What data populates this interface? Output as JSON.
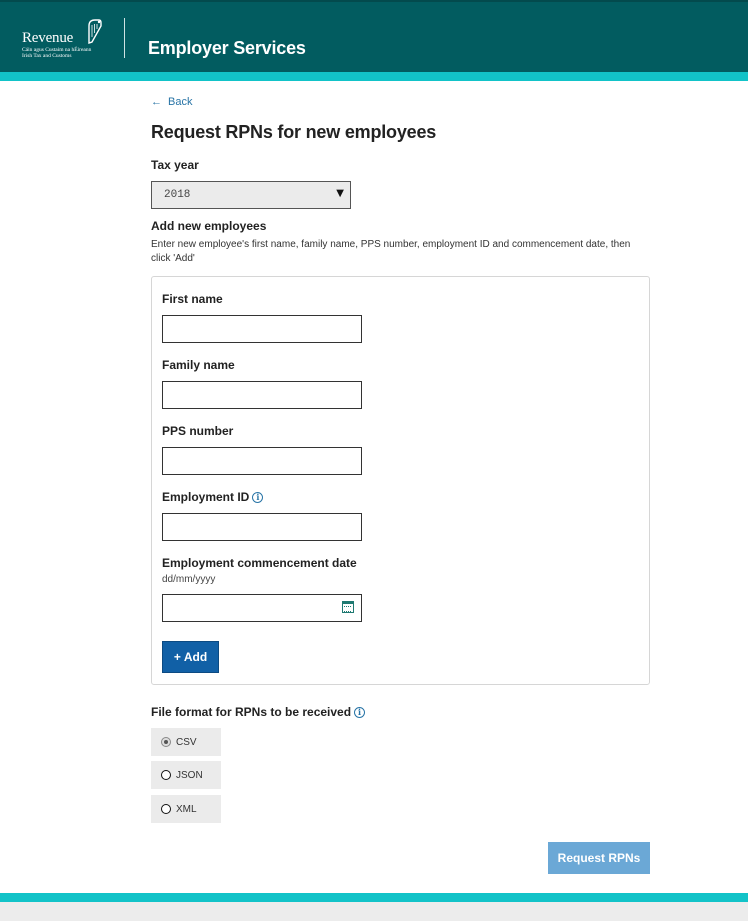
{
  "header": {
    "logo_name": "Revenue",
    "logo_sub_irish": "Cáin agus Custaim na hÉireann",
    "logo_sub_english": "Irish Tax and Customs",
    "title": "Employer Services"
  },
  "nav": {
    "back_label": "Back"
  },
  "page": {
    "title": "Request RPNs for new employees"
  },
  "tax_year": {
    "label": "Tax year",
    "selected": "2018"
  },
  "add_employees": {
    "label": "Add new employees",
    "help": "Enter new employee's first name, family name, PPS number, employment ID and commencement date, then click 'Add'",
    "fields": {
      "first_name": {
        "label": "First name",
        "value": ""
      },
      "family_name": {
        "label": "Family name",
        "value": ""
      },
      "pps_number": {
        "label": "PPS number",
        "value": ""
      },
      "employment_id": {
        "label": "Employment ID",
        "value": ""
      },
      "commencement_date": {
        "label": "Employment commencement date",
        "hint": "dd/mm/yyyy",
        "value": ""
      }
    },
    "add_button": "Add"
  },
  "file_format": {
    "label": "File format for RPNs to be received",
    "options": [
      {
        "label": "CSV",
        "selected": true
      },
      {
        "label": "JSON",
        "selected": false
      },
      {
        "label": "XML",
        "selected": false
      }
    ]
  },
  "actions": {
    "request_button": "Request RPNs"
  },
  "colors": {
    "header": "#025c60",
    "stripe": "#12c3c8",
    "primary_button": "#1160a6",
    "disabled_button": "#6ba8d6",
    "link": "#2874a6"
  }
}
